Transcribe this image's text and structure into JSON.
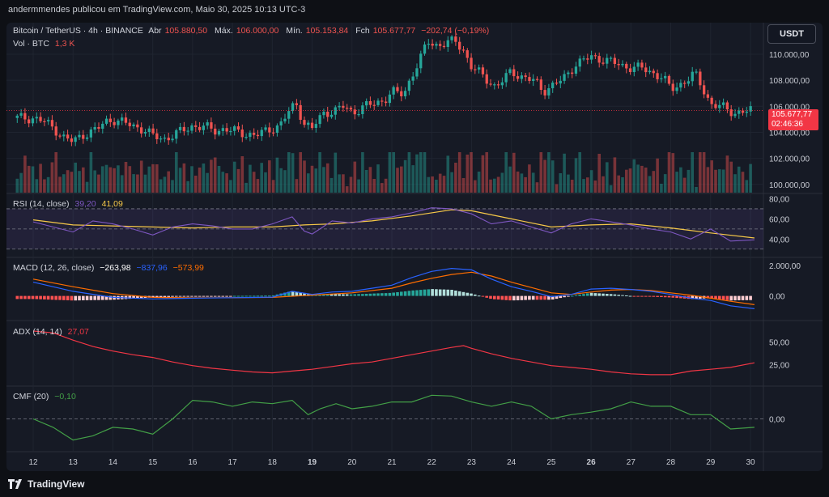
{
  "header": {
    "publisher_line": "andermmendes publicou em TradingView.com, Maio 30, 2025 10:13 UTC-3",
    "currency_button": "USDT"
  },
  "symbol_legend": {
    "title": "Bitcoin / TetherUS · 4h · BINANCE",
    "open_label": "Abr",
    "open": "105.880,50",
    "high_label": "Máx.",
    "high": "106.000,00",
    "low_label": "Mín.",
    "low": "105.153,84",
    "close_label": "Fch",
    "close": "105.677,77",
    "change": "−202,74 (−0,19%)",
    "vol_label": "Vol · BTC",
    "vol": "1,3 K"
  },
  "price_tag": {
    "price": "105.677,77",
    "countdown": "02:46:36"
  },
  "price_axis_labels": [
    "110.000,00",
    "108.000,00",
    "106.000,00",
    "104.000,00",
    "102.000,00",
    "100.000,00"
  ],
  "rsi": {
    "label": "RSI (14, close)",
    "value": "39,20",
    "ma": "41,09",
    "axis": [
      "80,00",
      "60,00",
      "40,00"
    ]
  },
  "macd": {
    "label": "MACD (12, 26, close)",
    "hist": "−263,98",
    "macd": "−837,96",
    "signal": "−573,99",
    "axis": [
      "2.000,00",
      "0,00"
    ]
  },
  "adx": {
    "label": "ADX (14, 14)",
    "value": "27,07",
    "axis": [
      "50,00",
      "25,00"
    ]
  },
  "cmf": {
    "label": "CMF (20)",
    "value": "−0,10",
    "axis": [
      "0,00"
    ]
  },
  "time_axis": [
    "12",
    "13",
    "14",
    "15",
    "16",
    "17",
    "18",
    "19",
    "20",
    "21",
    "22",
    "23",
    "24",
    "25",
    "26",
    "27",
    "28",
    "29",
    "30"
  ],
  "footer": {
    "brand": "TradingView"
  },
  "colors": {
    "up": "#26a69a",
    "down": "#ef5350",
    "rsi": "#7e57c2",
    "rsi_ma": "#f7c948",
    "macd": "#2962ff",
    "signal": "#ff6d00",
    "adx": "#f23645",
    "cmf": "#43a047"
  },
  "chart_data": {
    "type": "candlestick",
    "symbol": "Bitcoin / TetherUS",
    "interval": "4h",
    "price_ylim": [
      99800,
      111800
    ],
    "close_path": [
      [
        12.0,
        105100
      ],
      [
        12.3,
        104800
      ],
      [
        12.6,
        104100
      ],
      [
        12.8,
        103500
      ],
      [
        13.0,
        103300
      ],
      [
        13.3,
        103900
      ],
      [
        13.6,
        104200
      ],
      [
        13.8,
        104800
      ],
      [
        14.0,
        105000
      ],
      [
        14.3,
        104700
      ],
      [
        14.6,
        104400
      ],
      [
        14.8,
        104200
      ],
      [
        15.0,
        103700
      ],
      [
        15.3,
        103500
      ],
      [
        15.6,
        103900
      ],
      [
        15.8,
        104200
      ],
      [
        16.0,
        104500
      ],
      [
        16.3,
        104400
      ],
      [
        16.6,
        104100
      ],
      [
        16.8,
        104300
      ],
      [
        17.0,
        104100
      ],
      [
        17.3,
        103900
      ],
      [
        17.6,
        103800
      ],
      [
        17.8,
        104000
      ],
      [
        18.0,
        104300
      ],
      [
        18.2,
        104600
      ],
      [
        18.4,
        105500
      ],
      [
        18.6,
        106200
      ],
      [
        18.8,
        104700
      ],
      [
        19.0,
        104300
      ],
      [
        19.3,
        105500
      ],
      [
        19.6,
        105700
      ],
      [
        19.8,
        106000
      ],
      [
        20.0,
        105500
      ],
      [
        20.3,
        106000
      ],
      [
        20.6,
        106200
      ],
      [
        20.8,
        106500
      ],
      [
        21.0,
        107100
      ],
      [
        21.3,
        106900
      ],
      [
        21.5,
        108400
      ],
      [
        21.7,
        109500
      ],
      [
        21.9,
        111000
      ],
      [
        22.1,
        110700
      ],
      [
        22.3,
        110800
      ],
      [
        22.6,
        111000
      ],
      [
        22.8,
        110300
      ],
      [
        23.0,
        109000
      ],
      [
        23.3,
        108300
      ],
      [
        23.6,
        107500
      ],
      [
        23.8,
        108000
      ],
      [
        24.0,
        108700
      ],
      [
        24.3,
        108200
      ],
      [
        24.6,
        107900
      ],
      [
        24.8,
        107200
      ],
      [
        25.0,
        107500
      ],
      [
        25.3,
        108100
      ],
      [
        25.6,
        109200
      ],
      [
        25.8,
        109500
      ],
      [
        26.0,
        109800
      ],
      [
        26.3,
        109600
      ],
      [
        26.6,
        109300
      ],
      [
        26.8,
        109100
      ],
      [
        27.0,
        109000
      ],
      [
        27.3,
        108900
      ],
      [
        27.6,
        108500
      ],
      [
        27.8,
        108200
      ],
      [
        28.0,
        107300
      ],
      [
        28.3,
        107800
      ],
      [
        28.6,
        108500
      ],
      [
        28.8,
        107400
      ],
      [
        29.0,
        106200
      ],
      [
        29.3,
        105900
      ],
      [
        29.6,
        105500
      ],
      [
        29.8,
        105600
      ],
      [
        30.1,
        105677
      ]
    ],
    "rsi_ylim": [
      25,
      82
    ],
    "rsi_bands": [
      70,
      50,
      30
    ],
    "rsi_path": [
      [
        12.0,
        57
      ],
      [
        12.5,
        52
      ],
      [
        13.0,
        47
      ],
      [
        13.5,
        58
      ],
      [
        14.0,
        55
      ],
      [
        14.5,
        50
      ],
      [
        15.0,
        44
      ],
      [
        15.5,
        52
      ],
      [
        16.0,
        55
      ],
      [
        16.5,
        53
      ],
      [
        17.0,
        50
      ],
      [
        17.5,
        50
      ],
      [
        18.0,
        55
      ],
      [
        18.5,
        62
      ],
      [
        18.8,
        48
      ],
      [
        19.0,
        45
      ],
      [
        19.5,
        58
      ],
      [
        20.0,
        56
      ],
      [
        20.5,
        60
      ],
      [
        21.0,
        62
      ],
      [
        21.5,
        66
      ],
      [
        22.0,
        71
      ],
      [
        22.5,
        70
      ],
      [
        23.0,
        65
      ],
      [
        23.5,
        55
      ],
      [
        24.0,
        58
      ],
      [
        24.5,
        52
      ],
      [
        25.0,
        46
      ],
      [
        25.5,
        55
      ],
      [
        26.0,
        60
      ],
      [
        26.5,
        57
      ],
      [
        27.0,
        54
      ],
      [
        27.5,
        50
      ],
      [
        28.0,
        47
      ],
      [
        28.5,
        40
      ],
      [
        29.0,
        50
      ],
      [
        29.5,
        38
      ],
      [
        30.1,
        39.2
      ]
    ],
    "rsi_ma_path": [
      [
        12.0,
        59
      ],
      [
        13.0,
        54
      ],
      [
        14.0,
        53
      ],
      [
        15.0,
        52
      ],
      [
        16.0,
        51
      ],
      [
        17.0,
        52
      ],
      [
        18.0,
        52
      ],
      [
        18.8,
        54
      ],
      [
        19.5,
        55
      ],
      [
        20.5,
        58
      ],
      [
        21.5,
        63
      ],
      [
        22.5,
        69
      ],
      [
        23.0,
        68
      ],
      [
        23.5,
        64
      ],
      [
        24.0,
        60
      ],
      [
        25.0,
        52
      ],
      [
        26.0,
        54
      ],
      [
        27.0,
        55
      ],
      [
        28.0,
        51
      ],
      [
        29.0,
        46
      ],
      [
        30.1,
        41.09
      ]
    ],
    "macd_ylim": [
      -1400,
      2200
    ],
    "macd_path": [
      [
        12.0,
        900
      ],
      [
        13.0,
        300
      ],
      [
        14.0,
        -100
      ],
      [
        15.0,
        -200
      ],
      [
        16.0,
        -150
      ],
      [
        17.0,
        -120
      ],
      [
        18.0,
        -80
      ],
      [
        18.5,
        300
      ],
      [
        19.0,
        100
      ],
      [
        19.5,
        250
      ],
      [
        20.0,
        300
      ],
      [
        20.5,
        500
      ],
      [
        21.0,
        700
      ],
      [
        21.5,
        1200
      ],
      [
        22.0,
        1600
      ],
      [
        22.5,
        1800
      ],
      [
        23.0,
        1700
      ],
      [
        23.5,
        1100
      ],
      [
        24.0,
        600
      ],
      [
        24.5,
        300
      ],
      [
        25.0,
        -50
      ],
      [
        25.5,
        100
      ],
      [
        26.0,
        450
      ],
      [
        26.5,
        500
      ],
      [
        27.0,
        420
      ],
      [
        27.5,
        300
      ],
      [
        28.0,
        100
      ],
      [
        28.5,
        -150
      ],
      [
        29.0,
        -300
      ],
      [
        29.5,
        -650
      ],
      [
        30.1,
        -838
      ]
    ],
    "signal_path": [
      [
        12.0,
        1100
      ],
      [
        13.0,
        600
      ],
      [
        14.0,
        150
      ],
      [
        15.0,
        -100
      ],
      [
        16.0,
        -130
      ],
      [
        17.0,
        -120
      ],
      [
        18.0,
        -100
      ],
      [
        19.0,
        50
      ],
      [
        20.0,
        200
      ],
      [
        21.0,
        500
      ],
      [
        21.5,
        850
      ],
      [
        22.0,
        1150
      ],
      [
        22.5,
        1400
      ],
      [
        23.0,
        1550
      ],
      [
        23.5,
        1300
      ],
      [
        24.0,
        900
      ],
      [
        24.5,
        550
      ],
      [
        25.0,
        200
      ],
      [
        25.5,
        100
      ],
      [
        26.0,
        250
      ],
      [
        26.5,
        380
      ],
      [
        27.0,
        420
      ],
      [
        27.5,
        350
      ],
      [
        28.0,
        200
      ],
      [
        28.5,
        50
      ],
      [
        29.0,
        -150
      ],
      [
        29.5,
        -350
      ],
      [
        30.1,
        -574
      ]
    ],
    "adx_ylim": [
      5,
      70
    ],
    "adx_path": [
      [
        12.0,
        62
      ],
      [
        12.5,
        60
      ],
      [
        13.0,
        52
      ],
      [
        13.5,
        45
      ],
      [
        14.0,
        40
      ],
      [
        14.5,
        36
      ],
      [
        15.0,
        33
      ],
      [
        15.5,
        28
      ],
      [
        16.0,
        24
      ],
      [
        16.5,
        21
      ],
      [
        17.0,
        19
      ],
      [
        17.5,
        17
      ],
      [
        18.0,
        16
      ],
      [
        18.5,
        18
      ],
      [
        19.0,
        20
      ],
      [
        19.5,
        23
      ],
      [
        20.0,
        26
      ],
      [
        20.5,
        28
      ],
      [
        21.0,
        32
      ],
      [
        21.5,
        36
      ],
      [
        22.0,
        40
      ],
      [
        22.5,
        44
      ],
      [
        22.8,
        46
      ],
      [
        23.0,
        43
      ],
      [
        23.5,
        37
      ],
      [
        24.0,
        32
      ],
      [
        24.5,
        28
      ],
      [
        25.0,
        24
      ],
      [
        25.5,
        22
      ],
      [
        26.0,
        20
      ],
      [
        26.5,
        17
      ],
      [
        27.0,
        15
      ],
      [
        27.5,
        14
      ],
      [
        28.0,
        14
      ],
      [
        28.5,
        18
      ],
      [
        29.0,
        20
      ],
      [
        29.5,
        22
      ],
      [
        30.1,
        27.07
      ]
    ],
    "cmf_ylim": [
      -0.35,
      0.35
    ],
    "cmf_path": [
      [
        12.0,
        0.0
      ],
      [
        12.5,
        -0.1
      ],
      [
        13.0,
        -0.25
      ],
      [
        13.5,
        -0.2
      ],
      [
        14.0,
        -0.1
      ],
      [
        14.5,
        -0.12
      ],
      [
        15.0,
        -0.18
      ],
      [
        15.5,
        0.0
      ],
      [
        16.0,
        0.22
      ],
      [
        16.5,
        0.2
      ],
      [
        17.0,
        0.15
      ],
      [
        17.5,
        0.2
      ],
      [
        18.0,
        0.18
      ],
      [
        18.5,
        0.22
      ],
      [
        18.9,
        0.05
      ],
      [
        19.2,
        0.12
      ],
      [
        19.6,
        0.18
      ],
      [
        20.0,
        0.12
      ],
      [
        20.5,
        0.15
      ],
      [
        21.0,
        0.2
      ],
      [
        21.5,
        0.2
      ],
      [
        22.0,
        0.28
      ],
      [
        22.5,
        0.27
      ],
      [
        23.0,
        0.2
      ],
      [
        23.5,
        0.15
      ],
      [
        24.0,
        0.2
      ],
      [
        24.5,
        0.15
      ],
      [
        25.0,
        0.0
      ],
      [
        25.5,
        0.05
      ],
      [
        26.0,
        0.08
      ],
      [
        26.5,
        0.12
      ],
      [
        27.0,
        0.2
      ],
      [
        27.5,
        0.15
      ],
      [
        28.0,
        0.15
      ],
      [
        28.5,
        0.05
      ],
      [
        29.0,
        0.05
      ],
      [
        29.5,
        -0.12
      ],
      [
        30.1,
        -0.1
      ]
    ]
  }
}
